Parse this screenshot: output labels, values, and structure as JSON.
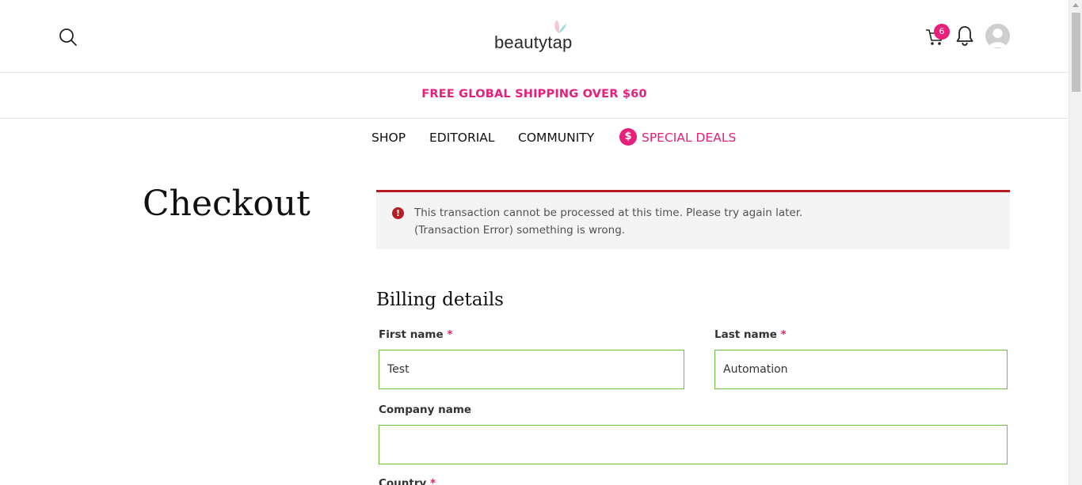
{
  "header": {
    "logo_text": "beautytap",
    "cart_count": "6"
  },
  "promo": {
    "text": "FREE GLOBAL SHIPPING OVER $60"
  },
  "nav": {
    "items": [
      {
        "label": "SHOP"
      },
      {
        "label": "EDITORIAL"
      },
      {
        "label": "COMMUNITY"
      },
      {
        "label": "SPECIAL DEALS",
        "icon": "$"
      }
    ]
  },
  "page": {
    "title": "Checkout"
  },
  "error": {
    "icon": "!",
    "line1": "This transaction cannot be processed at this time. Please try again later.",
    "line2": "(Transaction Error) something is wrong."
  },
  "billing": {
    "title": "Billing details",
    "required_mark": "*",
    "first_name": {
      "label": "First name",
      "value": "Test"
    },
    "last_name": {
      "label": "Last name",
      "value": "Automation"
    },
    "company_name": {
      "label": "Company name",
      "value": ""
    },
    "country": {
      "label": "Country"
    }
  },
  "colors": {
    "accent": "#e91e7a",
    "error": "#b81c23",
    "field_border_valid": "#6abf40"
  }
}
